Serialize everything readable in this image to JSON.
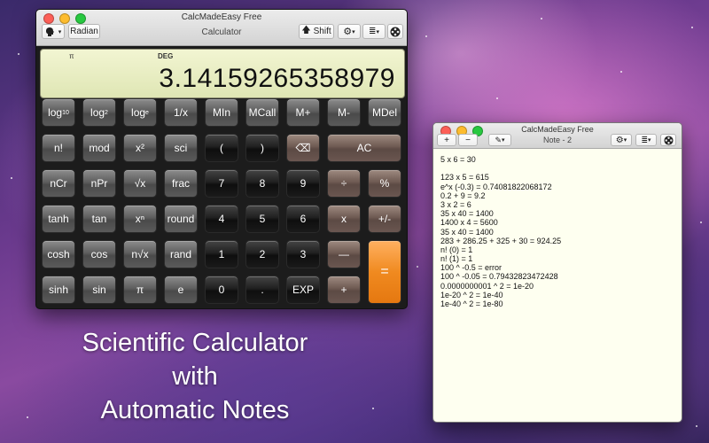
{
  "calculator": {
    "window_title": "CalcMadeEasy Free",
    "subtitle": "Calculator",
    "toolbar": {
      "radian_label": "Radian",
      "shift_label": "Shift"
    },
    "display": {
      "pi_indicator": "π",
      "angle_mode": "DEG",
      "value": "3.14159265358979"
    },
    "keys": [
      [
        "log10",
        "log2",
        "loge",
        "1/x",
        "MIn",
        "MCall",
        "M+",
        "M-",
        "MDel"
      ],
      [
        "n!",
        "mod",
        "x²",
        "sci",
        "(",
        ")",
        "⌫",
        "AC"
      ],
      [
        "nCr",
        "nPr",
        "√x",
        "frac",
        "7",
        "8",
        "9",
        "÷",
        "%"
      ],
      [
        "tanh",
        "tan",
        "xⁿ",
        "round",
        "4",
        "5",
        "6",
        "x",
        "+/-"
      ],
      [
        "cosh",
        "cos",
        "n√x",
        "rand",
        "1",
        "2",
        "3",
        "—",
        "="
      ],
      [
        "sinh",
        "sin",
        "π",
        "e",
        "0",
        ".",
        "EXP",
        "+"
      ]
    ]
  },
  "note": {
    "window_title": "CalcMadeEasy Free",
    "subtitle": "Note - 2",
    "toolbar": {
      "add_label": "+",
      "remove_label": "−"
    },
    "lines": [
      "5 x 6 = 30",
      "",
      "123 x 5 = 615",
      "e^x (-0.3) = 0.74081822068172",
      "0.2 + 9 = 9.2",
      "3 x 2 = 6",
      "35 x 40 = 1400",
      "1400 x 4 = 5600",
      "35 x 40 = 1400",
      "283 + 286.25 + 325 + 30 = 924.25",
      "n! (0) = 1",
      "n! (1) = 1",
      "100 ^ -0.5 = error",
      "100 ^ -0.05 = 0.79432823472428",
      "0.0000000001 ^ 2 = 1e-20",
      "1e-20 ^ 2 = 1e-40",
      "1e-40 ^ 2 = 1e-80"
    ]
  },
  "caption": [
    "Scientific Calculator",
    "with",
    "Automatic Notes"
  ],
  "colors": {
    "equals_key": "#f08a20",
    "display_bg": "#eef2cc",
    "note_bg": "#fefff0"
  }
}
